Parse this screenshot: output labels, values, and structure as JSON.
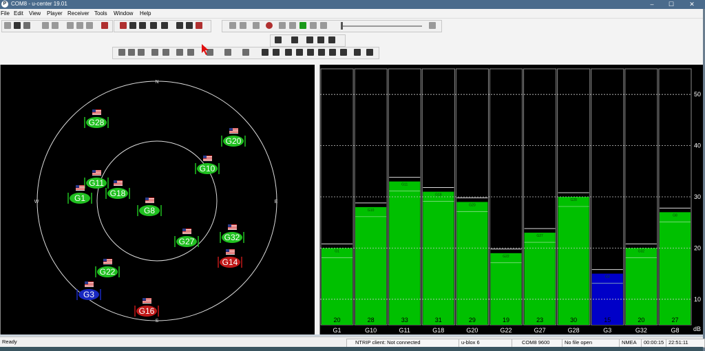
{
  "window": {
    "title": "COM8 - u-center 19.01",
    "app_icon": "P",
    "controls": [
      "–",
      "☐",
      "✕"
    ]
  },
  "menu": [
    "File",
    "Edit",
    "View",
    "Player",
    "Receiver",
    "Tools",
    "Window",
    "Help"
  ],
  "sky_view": {
    "compass": {
      "n": "N",
      "s": "S",
      "e": "E",
      "w": "W"
    },
    "satellites": [
      {
        "label": "G28",
        "color": "#20c020",
        "flag": true
      },
      {
        "label": "G20",
        "color": "#20c020",
        "flag": true
      },
      {
        "label": "G10",
        "color": "#20c020",
        "flag": true
      },
      {
        "label": "G11",
        "color": "#20c020",
        "flag": true
      },
      {
        "label": "G1",
        "color": "#20c020",
        "flag": true
      },
      {
        "label": "G18",
        "color": "#20c020",
        "flag": true
      },
      {
        "label": "G8",
        "color": "#20c020",
        "flag": true
      },
      {
        "label": "G27",
        "color": "#20c020",
        "flag": true
      },
      {
        "label": "G32",
        "color": "#20c020",
        "flag": true
      },
      {
        "label": "G14",
        "color": "#c01818",
        "flag": true
      },
      {
        "label": "G22",
        "color": "#20c020",
        "flag": true
      },
      {
        "label": "G3",
        "color": "#1828c0",
        "flag": true
      },
      {
        "label": "G16",
        "color": "#c01818",
        "flag": true
      }
    ]
  },
  "chart_data": {
    "type": "bar",
    "categories": [
      "G1",
      "G10",
      "G11",
      "G18",
      "G20",
      "G22",
      "G27",
      "G28",
      "G3",
      "G32",
      "G8"
    ],
    "values": [
      20,
      28,
      33,
      31,
      29,
      19,
      23,
      30,
      15,
      20,
      27
    ],
    "colors": [
      "#00c000",
      "#00c000",
      "#00c000",
      "#00c000",
      "#00c000",
      "#00c000",
      "#00c000",
      "#00c000",
      "#0000c8",
      "#00c000",
      "#00c000"
    ],
    "ylim": [
      5,
      55
    ],
    "yticks": [
      10,
      20,
      30,
      40,
      50
    ],
    "ylabel": "dB",
    "grid": true
  },
  "status": {
    "ready": "Ready",
    "ntrip": "NTRIP client: Not connected",
    "receiver": "u-blox 6",
    "port": "COM8 9600",
    "file": "No file open",
    "protocol": "NMEA",
    "elapsed": "00:00:15",
    "clock": "22:51:11"
  }
}
